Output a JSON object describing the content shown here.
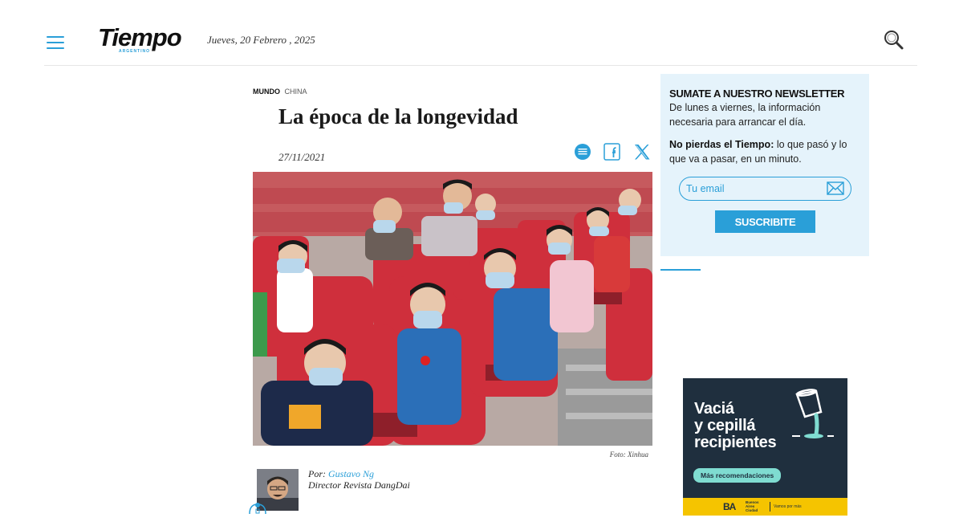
{
  "header": {
    "logo_text": "Tiempo",
    "logo_sub": "ARGENTINO",
    "date": "Jueves, 20 Febrero , 2025",
    "menu_icon": "hamburger-menu-icon",
    "search_icon": "search-icon"
  },
  "article": {
    "section": "MUNDO",
    "tag": "CHINA",
    "title": "La época de la longevidad",
    "date": "27/11/2021",
    "share_icons": [
      "whatsapp-icon",
      "facebook-icon",
      "x-twitter-icon"
    ],
    "photo_credit": "Foto: Xinhua",
    "author": {
      "prefix": "Por:",
      "name": "Gustavo Ng",
      "role": "Director Revista DangDai"
    }
  },
  "newsletter": {
    "heading": "SUMATE A NUESTRO NEWSLETTER",
    "text": "De lunes a viernes, la información necesaria para arrancar el día.",
    "text2_bold": "No pierdas el Tiempo:",
    "text2": " lo que pasó y lo que va a pasar, en un minuto.",
    "email_placeholder": "Tu email",
    "button_label": "SUSCRIBITE"
  },
  "ad": {
    "headline_1": "Vaciá",
    "headline_2": "y cepillá",
    "headline_3": "recipientes",
    "cta": "Más recomendaciones",
    "brand": "BA",
    "brand_sub_1": "Buenos",
    "brand_sub_2": "Aires",
    "brand_sub_3": "Ciudad",
    "tagline": "Vamos por más"
  },
  "colors": {
    "accent": "#2a9fd8",
    "newsletter_bg": "#e5f3fb",
    "ad_bg": "#1f2f3e",
    "ad_yellow": "#f5c400",
    "ad_teal": "#7fdcd1"
  }
}
